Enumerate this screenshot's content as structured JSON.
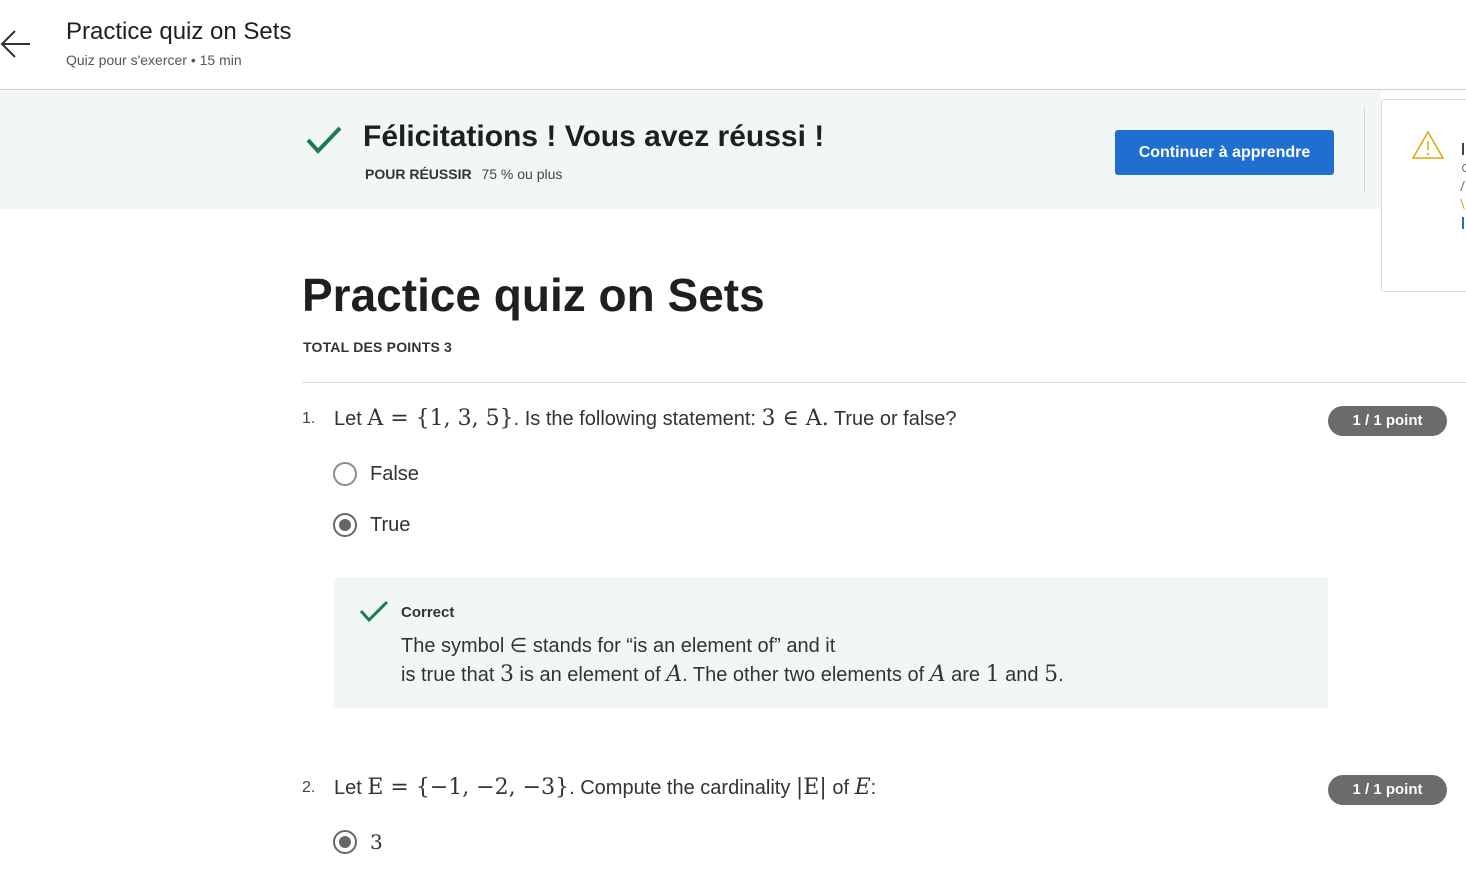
{
  "header": {
    "title": "Practice quiz on Sets",
    "subtitle": "Quiz pour s'exercer • 15 min"
  },
  "banner": {
    "title": "Félicitations ! Vous avez réussi !",
    "pass_label": "POUR RÉUSSIR",
    "pass_value": "75 % ou plus",
    "continue_label": "Continuer à apprendre"
  },
  "main": {
    "title": "Practice quiz on Sets",
    "total_points_label": "TOTAL DES POINTS",
    "total_points_value": "3"
  },
  "questions": [
    {
      "number": "1.",
      "text_prefix": "Let ",
      "set_def": "A = {1, 3, 5}",
      "text_middle": ". Is the following statement: ",
      "math_statement": "3 ∈ A.",
      "text_suffix": " True or false?",
      "points": "1 / 1 point",
      "options": [
        {
          "label": "False",
          "selected": false
        },
        {
          "label": "True",
          "selected": true
        }
      ],
      "feedback": {
        "title": "Correct",
        "line1": "The symbol ∈ stands for “is an element of” and it",
        "line2_a": "is true that ",
        "line2_m1": "3",
        "line2_b": " is an element of ",
        "line2_m2": "A",
        "line2_c": ". The other two elements of ",
        "line2_m3": "A",
        "line2_d": " are ",
        "line2_m4": "1",
        "line2_e": " and ",
        "line2_m5": "5",
        "line2_f": "."
      }
    },
    {
      "number": "2.",
      "text_prefix": "Let ",
      "set_def": "E = {−1, −2, −3}",
      "text_middle": ". Compute the cardinality ",
      "math_card": "|E|",
      "text_of": " of ",
      "math_e": "E",
      "text_suffix": ":",
      "points": "1 / 1 point",
      "options": [
        {
          "label": "3",
          "selected": true
        }
      ]
    }
  ],
  "colors": {
    "accent": "#1f6fd1",
    "success": "#1f7a4d",
    "banner_bg": "#f1f7f4",
    "badge_bg": "#6b6b6b",
    "warning": "#e0a800"
  },
  "icons": [
    "back-arrow-icon",
    "checkmark-icon",
    "warning-icon"
  ]
}
